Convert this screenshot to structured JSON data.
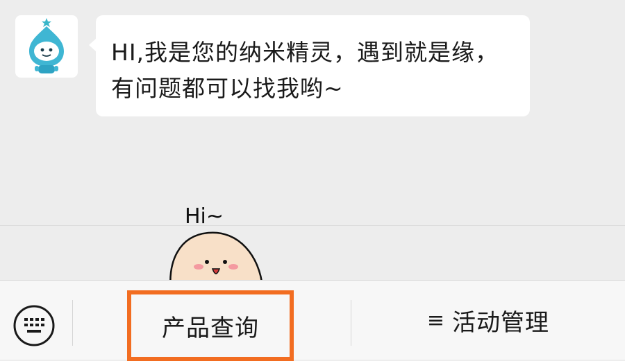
{
  "chat": {
    "bot_message": "HI,我是您的纳米精灵，遇到就是缘，\n有问题都可以找我哟~"
  },
  "sticker": {
    "text": "Hi~"
  },
  "menu": {
    "items": [
      {
        "label": "产品查询"
      },
      {
        "icon": "≡",
        "label": "活动管理"
      }
    ]
  },
  "colors": {
    "highlight": "#f26d21",
    "chat_background": "#ededed",
    "bubble": "#ffffff"
  },
  "icons": [
    "robot-avatar-icon",
    "keyboard-icon",
    "menu-lines-icon"
  ]
}
